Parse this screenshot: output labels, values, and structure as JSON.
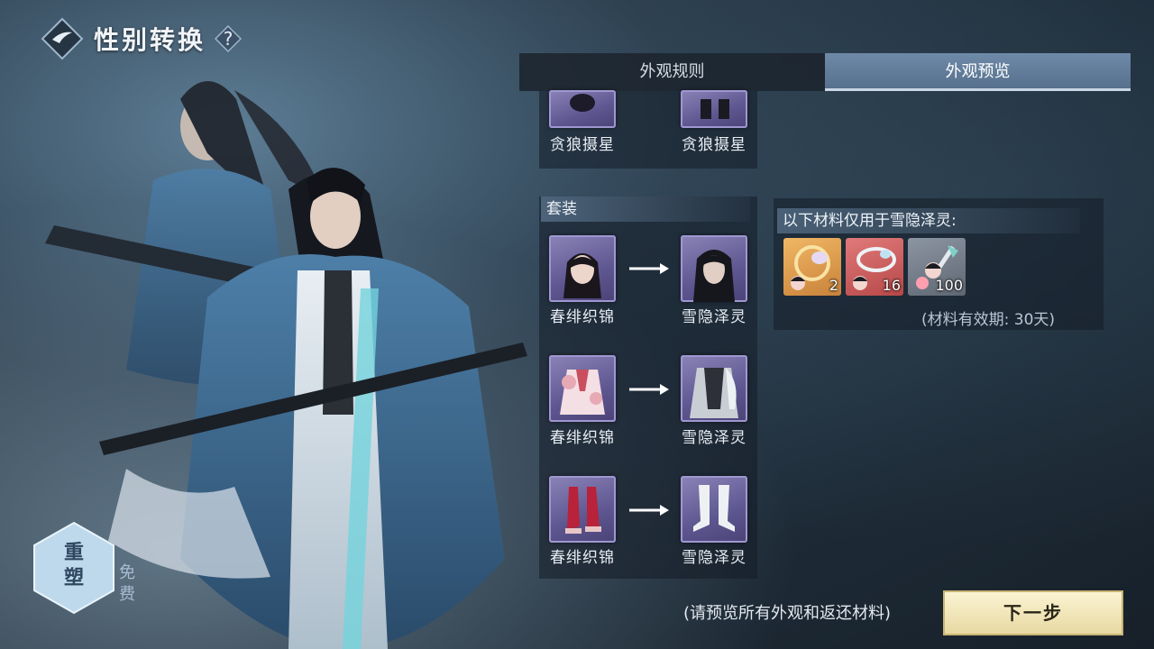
{
  "header": {
    "title": "性别转换",
    "help_symbol": "?"
  },
  "tabs": [
    {
      "label": "外观规则",
      "active": false
    },
    {
      "label": "外观预览",
      "active": true
    }
  ],
  "top_row": {
    "from_label": "贪狼摄星",
    "to_label": "贪狼摄星"
  },
  "outfit": {
    "header": "套装",
    "rows": [
      {
        "from_label": "春绯织锦",
        "from_icon": "face-portrait-female",
        "to_label": "雪隐泽灵",
        "to_icon": "face-portrait-male"
      },
      {
        "from_label": "春绯织锦",
        "from_icon": "robe-pink",
        "to_label": "雪隐泽灵",
        "to_icon": "robe-grey"
      },
      {
        "from_label": "春绯织锦",
        "from_icon": "boots-red",
        "to_label": "雪隐泽灵",
        "to_icon": "boots-white"
      }
    ]
  },
  "materials": {
    "header": "以下材料仅用于雪隐泽灵:",
    "items": [
      {
        "count": "2",
        "icon": "hair-ornament-gold",
        "bg": "#d99a4a"
      },
      {
        "count": "16",
        "icon": "ring-crystal-red",
        "bg": "#c95b5b"
      },
      {
        "count": "100",
        "icon": "hairpin-grey",
        "bg": "#77808c"
      }
    ],
    "validity": "(材料有效期: 30天)"
  },
  "reshape": {
    "label_top": "重",
    "label_bottom": "塑",
    "free_top": "免",
    "free_bottom": "费"
  },
  "footer": {
    "hint": "(请预览所有外观和返还材料)",
    "next_label": "下一步"
  }
}
